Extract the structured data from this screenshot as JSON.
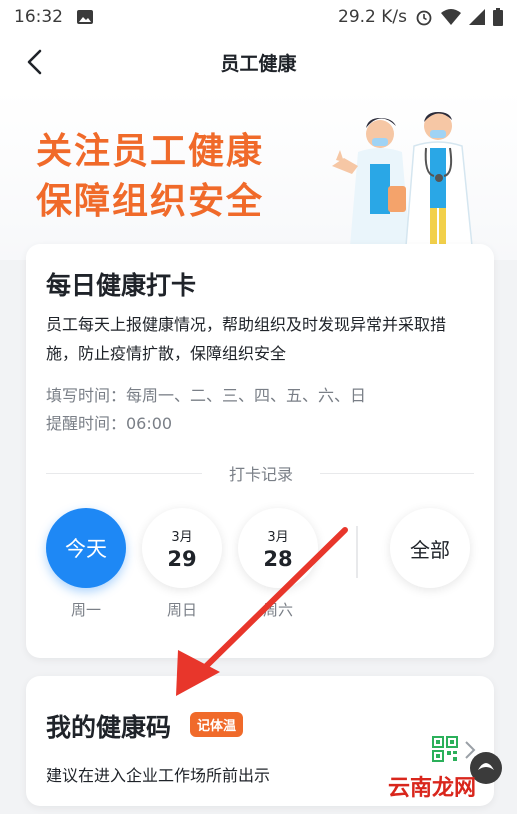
{
  "status_bar": {
    "time": "16:32",
    "network_speed": "29.2 K/s",
    "icons": [
      "image-icon",
      "alarm-icon",
      "wifi-icon",
      "cell-signal-icon",
      "battery-icon"
    ]
  },
  "nav": {
    "title": "员工健康",
    "back_icon": "chevron-left-icon"
  },
  "banner": {
    "line1": "关注员工健康",
    "line2": "保障组织安全",
    "illustration": "doctors-illustration"
  },
  "checkin": {
    "title": "每日健康打卡",
    "description": "员工每天上报健康情况，帮助组织及时发现异常并采取措施，防止疫情扩散，保障组织安全",
    "fill_time": "填写时间：每周一、二、三、四、五、六、日",
    "remind_time": "提醒时间：06:00",
    "records_label": "打卡记录",
    "days": [
      {
        "label": "今天",
        "weekday": "周一"
      },
      {
        "month": "3月",
        "date": "29",
        "weekday": "周日"
      },
      {
        "month": "3月",
        "date": "28",
        "weekday": "周六"
      }
    ],
    "all_label": "全部"
  },
  "health_code": {
    "title": "我的健康码",
    "tag": "记体温",
    "description": "建议在进入企业工作场所前出示",
    "icons": [
      "qr-code-icon",
      "chevron-right-icon"
    ]
  },
  "watermark": {
    "text": "云南龙网"
  },
  "colors": {
    "accent": "#1e88f5",
    "orange": "#f06a2a",
    "annotation_arrow": "#e8362b"
  }
}
